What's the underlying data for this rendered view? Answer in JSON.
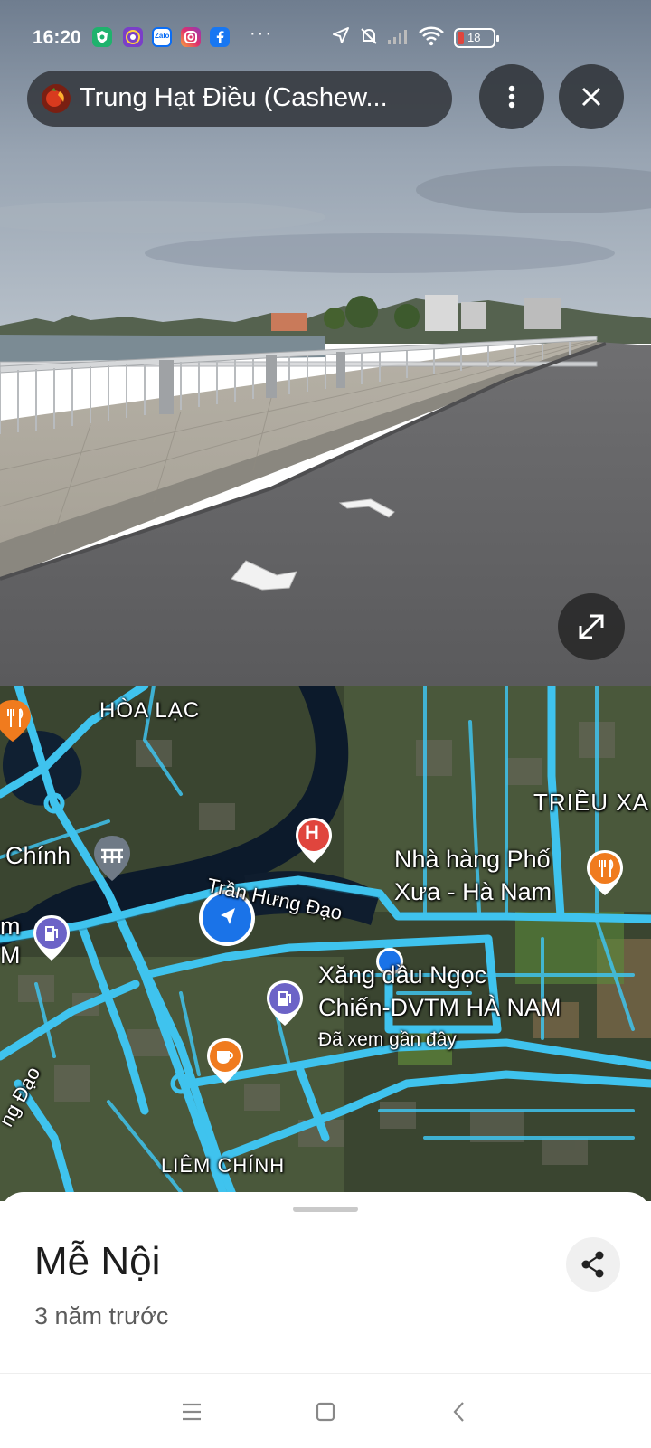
{
  "status_bar": {
    "time": "16:20",
    "zalo_label": "Zalo",
    "overflow": "···",
    "battery": "18",
    "apps": [
      "shield-app-icon",
      "circle-app-icon",
      "zalo-icon",
      "instagram-icon",
      "facebook-icon"
    ]
  },
  "header": {
    "place_title": "Trung Hạt Điều (Cashew..."
  },
  "map": {
    "labels": {
      "hoa_lac": "HÒA LẠC",
      "trieu_xa": "TRIỀU XA",
      "chinh": "Chính",
      "m": "m",
      "m2": "M",
      "restaurant_line1": "Nhà hàng Phố",
      "restaurant_line2": "Xưa - Hà Nam",
      "road_tran_hung_dao": "Trần Hưng Đạo",
      "gas_line1": "Xăng dầu Ngọc",
      "gas_line2": "Chiến-DVTM HÀ NAM",
      "recent": "Đã xem gần đây",
      "road_left": "ng Đạo",
      "liem_chinh": "LIÊM CHÍNH",
      "hospital_letter": "H"
    }
  },
  "sheet": {
    "title": "Mễ Nội",
    "subtitle": "3 năm trước"
  },
  "colors": {
    "road": "#3fc3ee",
    "pill": "#34383e",
    "poi_orange": "#f07b1e",
    "poi_purple": "#6c63c7",
    "hospital_red": "#e0453d",
    "location_blue": "#1a73e8"
  }
}
